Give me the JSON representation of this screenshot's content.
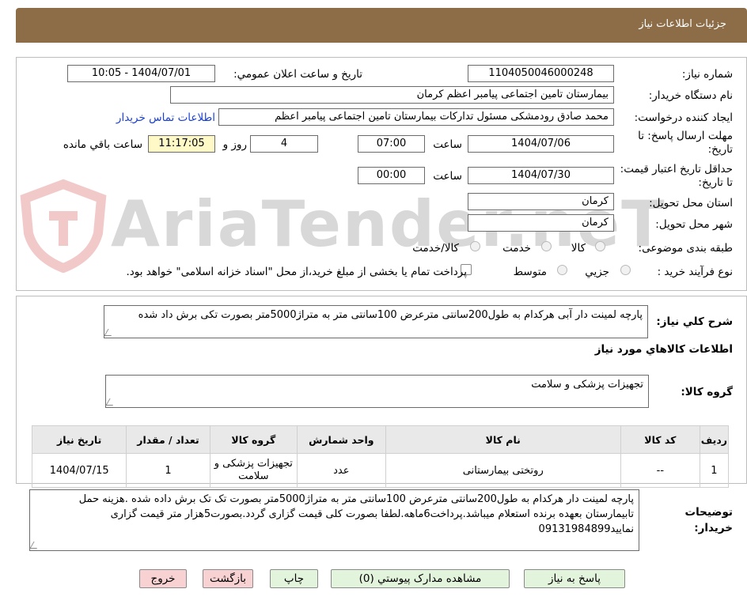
{
  "header": {
    "title": "جزئیات اطلاعات نیاز"
  },
  "watermark": {
    "text": "AriaTender.neT"
  },
  "need": {
    "number_label": "شماره نیاز:",
    "number": "1104050046000248",
    "announce_label": "تاریخ و ساعت اعلان عمومي:",
    "announce_value": "1404/07/01 - 10:05",
    "buyer_label": "نام دستگاه خریدار:",
    "buyer": "بیمارستان تامین اجتماعی پیامبر اعظم کرمان",
    "creator_label": "ایجاد کننده درخواست:",
    "creator": "محمد صادق  رودمشکی مسئول تدارکات بیمارستان تامین اجتماعی پیامبر اعظم",
    "contact_link": "اطلاعات تماس خریدار",
    "deadline_label": "مهلت ارسال پاسخ: تا تاریخ:",
    "deadline_date": "1404/07/06",
    "time_label": "ساعت",
    "deadline_time": "07:00",
    "days": "4",
    "days_label": "روز و",
    "time_left": "11:17:05",
    "time_left_label": "ساعت باقي مانده",
    "validity_label": "حداقل تاریخ اعتبار قیمت: تا تاریخ:",
    "validity_date": "1404/07/30",
    "validity_time": "00:00",
    "province_label": "استان محل تحویل:",
    "province": "کرمان",
    "city_label": "شهر محل تحویل:",
    "city": "کرمان",
    "category_label": "طبقه بندی موضوعی:",
    "category_options": [
      "کالا",
      "خدمت",
      "کالا/خدمت"
    ],
    "process_label": "نوع فرآیند خرید :",
    "process_options": [
      "جزیي",
      "متوسط"
    ],
    "payment_note": "پرداخت تمام یا بخشی از مبلغ خرید،از محل \"اسناد خزانه اسلامی\" خواهد بود."
  },
  "summary": {
    "label": "شرح کلي نیاز:",
    "text": "پارچه لمینت دار آبی هرکدام به طول200سانتی مترعرض 100سانتی متر به متراژ5000متر بصورت تکی برش داد شده"
  },
  "goods": {
    "section_title": "اطلاعات کالاهاي مورد نیاز",
    "group_label": "گروه کالا:",
    "group_value": "تجهیزات پزشکی و سلامت",
    "columns": [
      "ردیف",
      "کد کالا",
      "نام کالا",
      "واحد شمارش",
      "گروه کالا",
      "تعداد / مقدار",
      "تاریخ نیاز"
    ],
    "rows": [
      [
        "1",
        "--",
        "روتختی بیمارستانی",
        "عدد",
        "تجهیزات پزشکی و سلامت",
        "1",
        "1404/07/15"
      ]
    ]
  },
  "buyer_notes": {
    "label": "توضیحات خریدار:",
    "text": "پارچه لمینت دار هرکدام به طول200سانتی مترعرض 100سانتی متر به متراژ5000متر بصورت تک تک برش داده شده .هزینه حمل تابیمارستان بعهده برنده استعلام میباشد.پرداخت6ماهه.لطفا بصورت کلی قیمت گزاری گردد.بصورت5هزار متر قیمت گزاری نمایید09131984899"
  },
  "buttons": {
    "reply": "پاسخ به نیاز",
    "attachments": "مشاهده مدارک پیوستي (0)",
    "print": "چاپ",
    "back": "بازگشت",
    "exit": "خروج"
  }
}
